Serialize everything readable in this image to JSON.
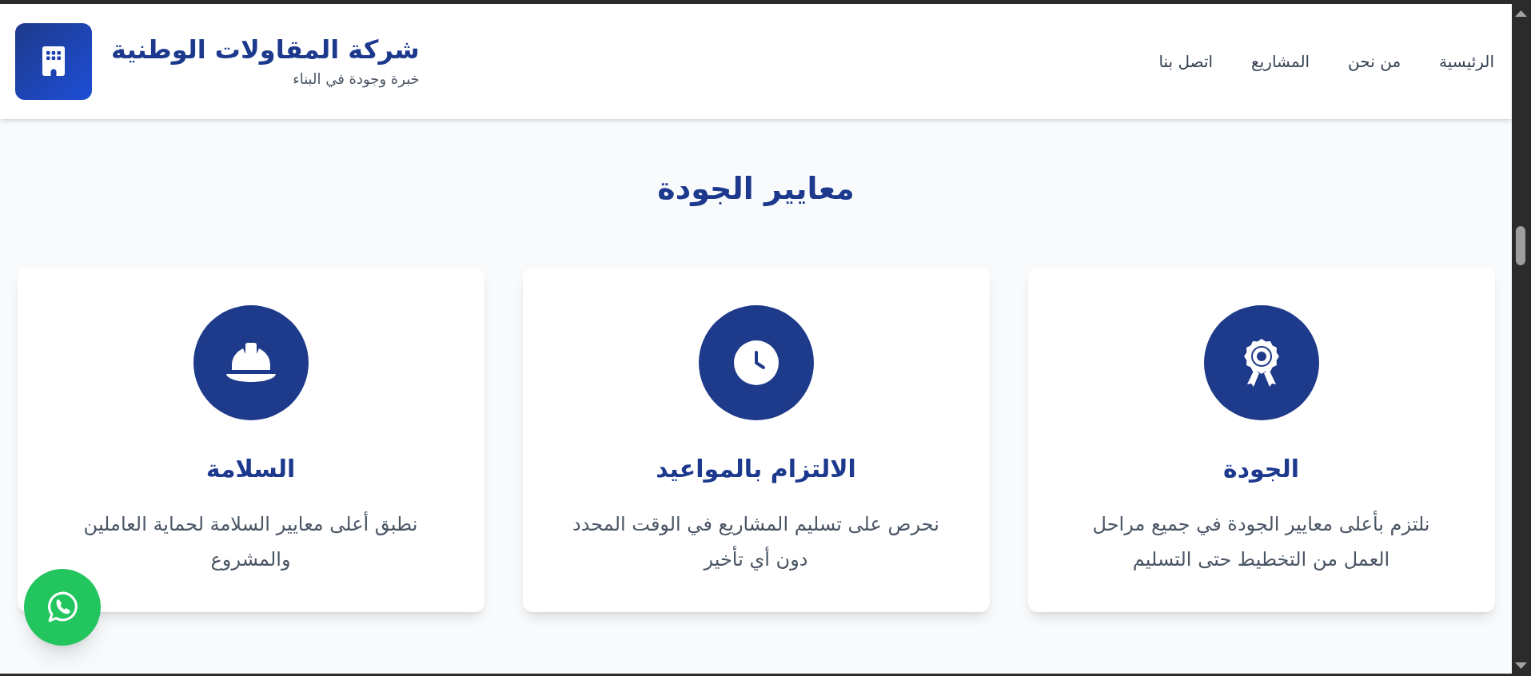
{
  "header": {
    "brand": {
      "name": "شركة المقاولات الوطنية",
      "tagline": "خبرة وجودة في البناء"
    },
    "nav": [
      {
        "label": "الرئيسية"
      },
      {
        "label": "من نحن"
      },
      {
        "label": "المشاريع"
      },
      {
        "label": "اتصل بنا"
      }
    ]
  },
  "section": {
    "title": "معايير الجودة",
    "cards": [
      {
        "kind": "award",
        "title": "الجودة",
        "text": "نلتزم بأعلى معايير الجودة في جميع مراحل العمل من التخطيط حتى التسليم"
      },
      {
        "kind": "clock",
        "title": "الالتزام بالمواعيد",
        "text": "نحرص على تسليم المشاريع في الوقت المحدد دون أي تأخير"
      },
      {
        "kind": "helmet",
        "title": "السلامة",
        "text": "نطبق أعلى معايير السلامة لحماية العاملين والمشروع"
      }
    ]
  }
}
